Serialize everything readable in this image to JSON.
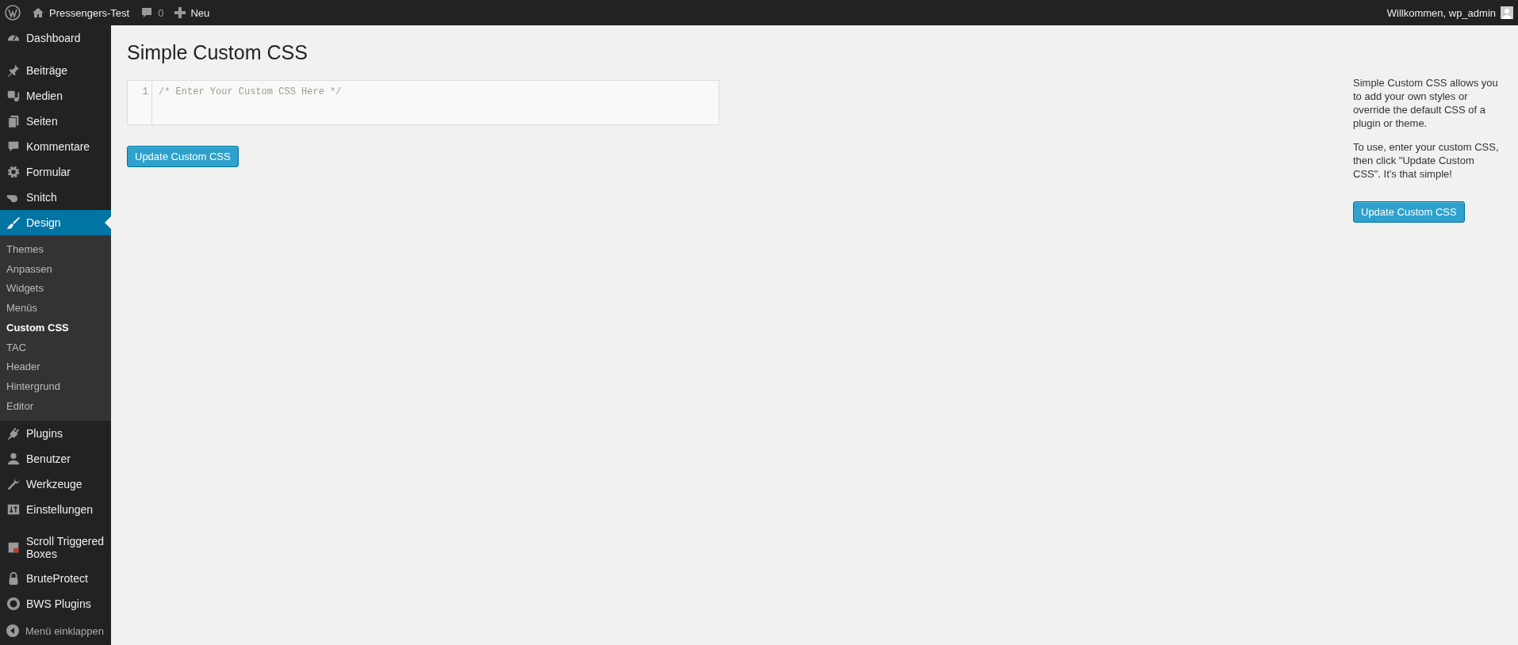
{
  "admin_bar": {
    "site_name": "Pressengers-Test",
    "comments_count": "0",
    "new_label": "Neu",
    "greeting": "Willkommen, wp_admin"
  },
  "sidebar": {
    "groups": [
      [
        {
          "label": "Dashboard",
          "selected": false
        }
      ],
      [
        {
          "label": "Beiträge",
          "selected": false
        },
        {
          "label": "Medien",
          "selected": false
        },
        {
          "label": "Seiten",
          "selected": false
        },
        {
          "label": "Kommentare",
          "selected": false
        },
        {
          "label": "Formular",
          "selected": false
        },
        {
          "label": "Snitch",
          "selected": false
        },
        {
          "label": "Design",
          "selected": true,
          "children": [
            {
              "label": "Themes",
              "selected": false
            },
            {
              "label": "Anpassen",
              "selected": false
            },
            {
              "label": "Widgets",
              "selected": false
            },
            {
              "label": "Menüs",
              "selected": false
            },
            {
              "label": "Custom CSS",
              "selected": true
            },
            {
              "label": "TAC",
              "selected": false
            },
            {
              "label": "Header",
              "selected": false
            },
            {
              "label": "Hintergrund",
              "selected": false
            },
            {
              "label": "Editor",
              "selected": false
            }
          ]
        },
        {
          "label": "Plugins",
          "selected": false
        },
        {
          "label": "Benutzer",
          "selected": false
        },
        {
          "label": "Werkzeuge",
          "selected": false
        },
        {
          "label": "Einstellungen",
          "selected": false
        }
      ],
      [
        {
          "label": "Scroll Triggered Boxes",
          "selected": false
        },
        {
          "label": "BruteProtect",
          "selected": false
        },
        {
          "label": "BWS Plugins",
          "selected": false
        }
      ]
    ],
    "collapse_label": "Menü einklappen"
  },
  "page": {
    "title": "Simple Custom CSS",
    "editor": {
      "line_numbers": [
        "1"
      ],
      "value": "/* Enter Your Custom CSS Here */"
    },
    "button": "Update Custom CSS"
  },
  "help_panel": {
    "paragraphs": [
      "Simple Custom CSS allows you to add your own styles or override the default CSS of a plugin or theme.",
      "To use, enter your custom CSS, then click \"Update Custom CSS\". It's that simple!"
    ],
    "button": "Update Custom CSS"
  }
}
